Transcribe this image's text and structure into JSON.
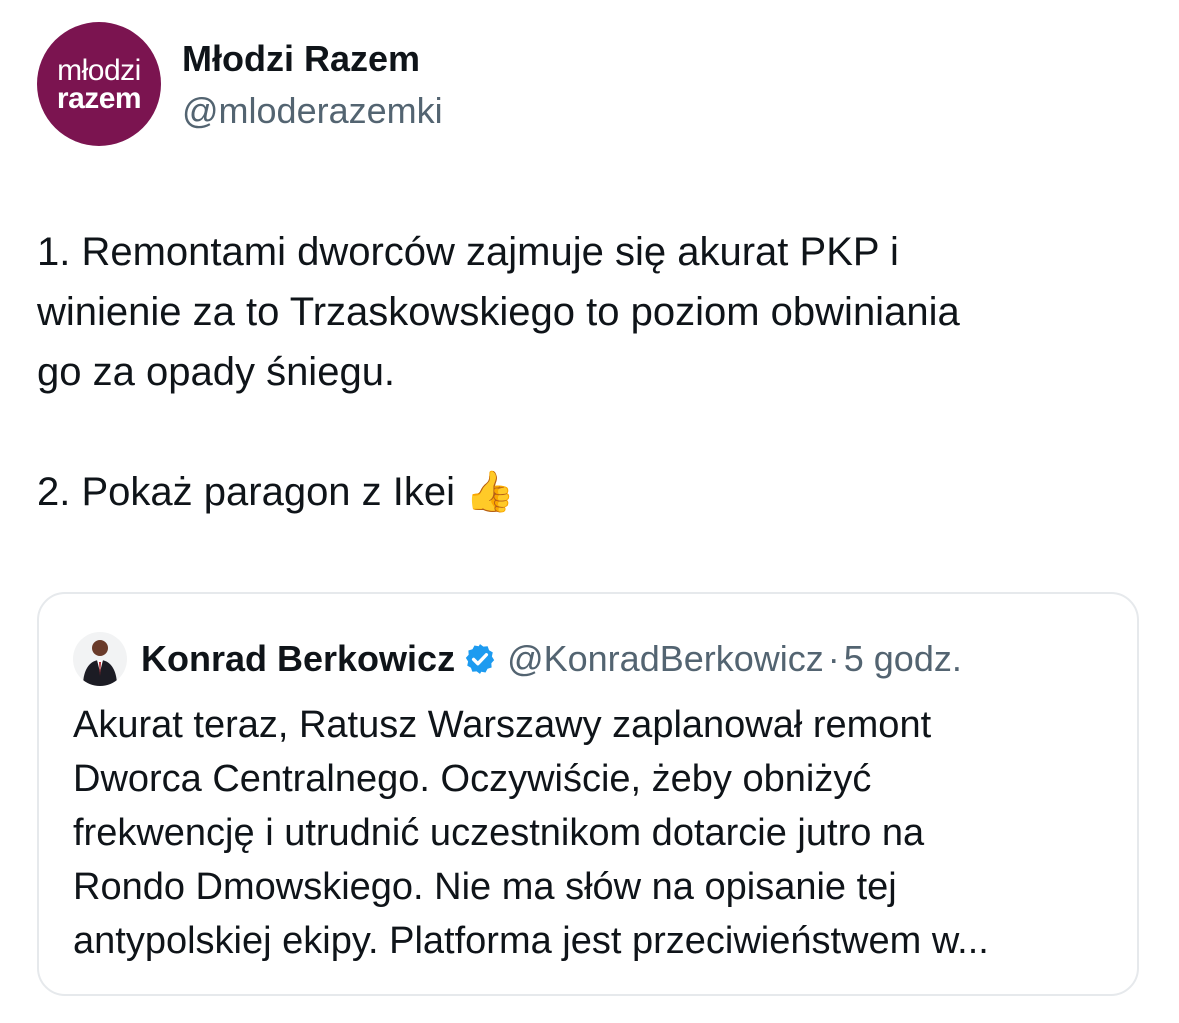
{
  "author": {
    "avatar_text_line1": "młodzi",
    "avatar_text_line2": "razem",
    "avatar_color": "#7b1450",
    "display_name": "Młodzi Razem",
    "handle": "@mloderazemki"
  },
  "tweet": {
    "paragraph1_lines": [
      "1. Remontami dworców zajmuje się akurat PKP i",
      "winienie za to Trzaskowskiego to poziom obwiniania",
      "go za opady śniegu."
    ],
    "paragraph2": "2. Pokaż paragon z Ikei",
    "emoji": "👍"
  },
  "quoted_tweet": {
    "display_name": "Konrad Berkowicz",
    "verified_icon": "verified-badge-icon",
    "verified_color": "#1d9bf0",
    "handle": "@KonradBerkowicz",
    "separator": "·",
    "time": "5 godz.",
    "text_lines": [
      "Akurat teraz, Ratusz Warszawy zaplanował remont",
      "Dworca Centralnego. Oczywiście, żeby obniżyć",
      "frekwencję i utrudnić uczestnikom dotarcie jutro na",
      "Rondo Dmowskiego. Nie ma słów na opisanie tej",
      "antypolskiej ekipy. Platforma jest przeciwieństwem w..."
    ]
  }
}
